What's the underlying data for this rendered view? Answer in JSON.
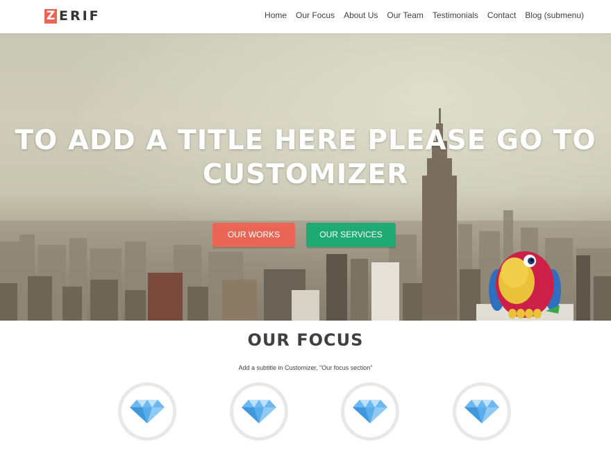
{
  "header": {
    "logo_letter": "Z",
    "logo_rest": "ERIF",
    "nav": [
      "Home",
      "Our Focus",
      "About Us",
      "Our Team",
      "Testimonials",
      "Contact",
      "Blog (submenu)"
    ]
  },
  "hero": {
    "title": "TO ADD A TITLE HERE PLEASE GO TO CUSTOMIZER",
    "buttons": {
      "works": "OUR WORKS",
      "services": "OUR SERVICES"
    }
  },
  "focus": {
    "title": "OUR FOCUS",
    "subtitle": "Add a subtitle in Customizer, \"Our focus section\"",
    "icons": [
      "diamond-icon",
      "diamond-icon",
      "diamond-icon",
      "diamond-icon"
    ]
  },
  "colors": {
    "accent_red": "#e96656",
    "accent_green": "#20aa73",
    "text": "#404040"
  }
}
